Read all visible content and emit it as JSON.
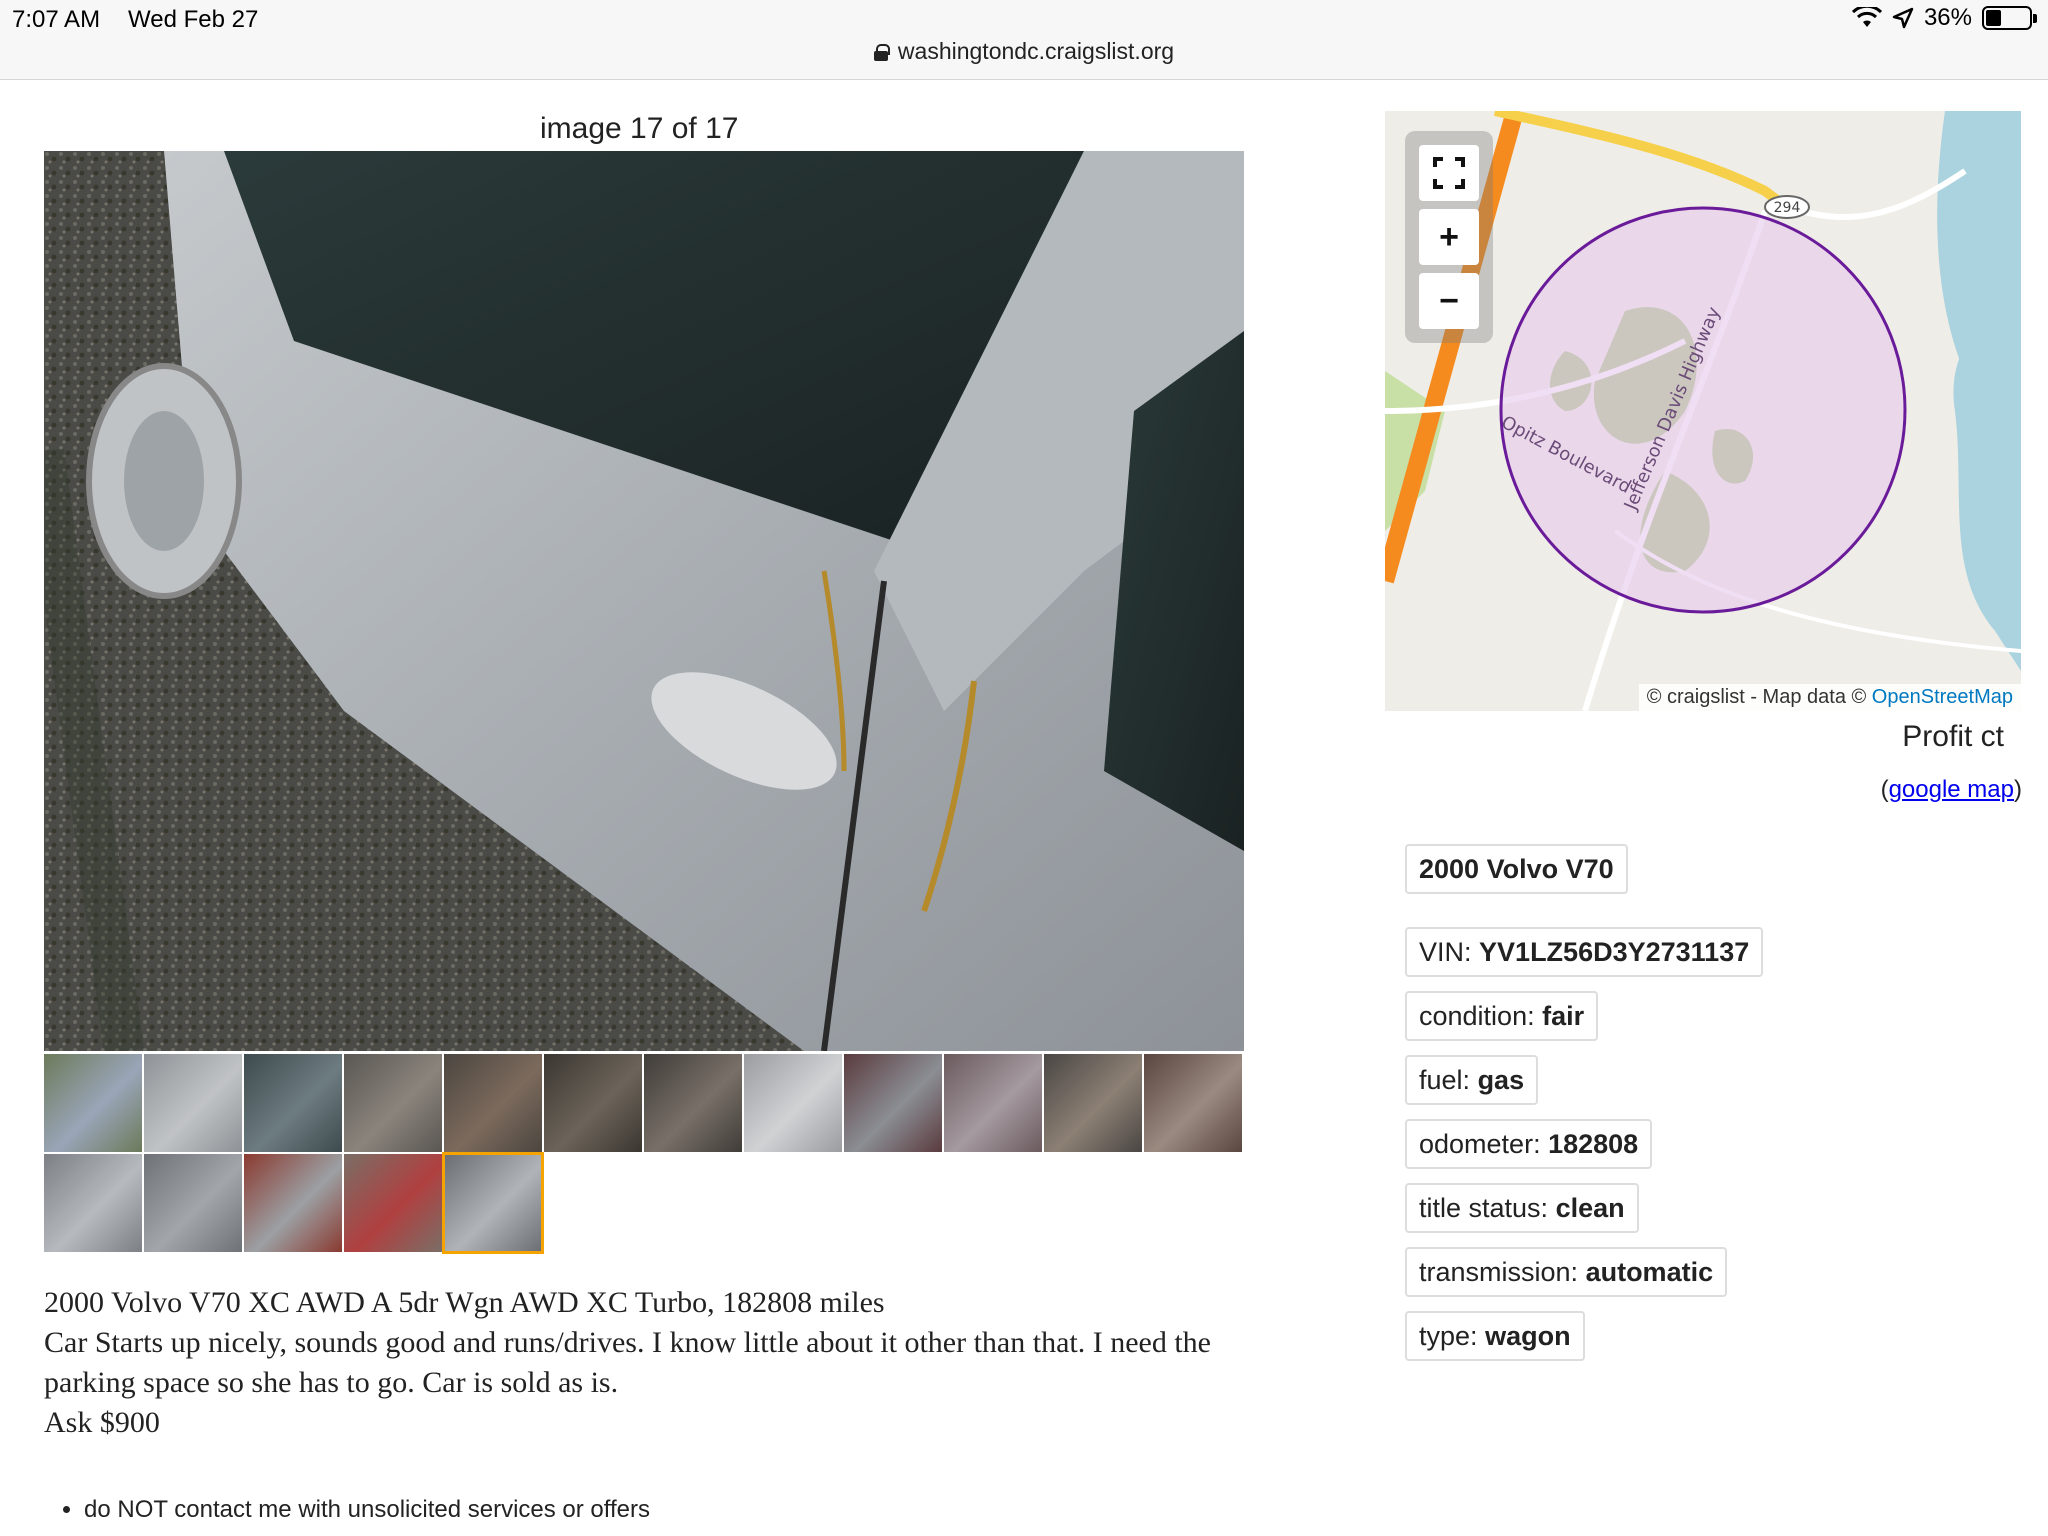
{
  "status_bar": {
    "time": "7:07 AM",
    "date": "Wed Feb 27",
    "battery_percent": "36%",
    "battery_level": 0.36,
    "icons": [
      "wifi-icon",
      "location-arrow-icon",
      "battery-icon"
    ]
  },
  "browser": {
    "url": "washingtondc.craigslist.org",
    "lock_icon": "lock-icon"
  },
  "gallery": {
    "counter": "image 17 of 17",
    "total": 17,
    "selected_index": 17
  },
  "map": {
    "controls": [
      "fullscreen-icon",
      "zoom-in-icon",
      "zoom-out-icon"
    ],
    "road_labels": [
      "294",
      "Opitz Boulevard",
      "Jefferson Davis Highway"
    ],
    "attribution_prefix": "© craigslist - Map data ©",
    "attribution_link": "OpenStreetMap",
    "area_label": "Profit ct",
    "google_map_open": "(",
    "google_map_link": "google map",
    "google_map_close": ")"
  },
  "attributes": {
    "title": "2000 Volvo V70",
    "vin_label": "VIN:",
    "vin_value": "YV1LZ56D3Y2731137",
    "condition_label": "condition:",
    "condition_value": "fair",
    "fuel_label": "fuel:",
    "fuel_value": "gas",
    "odometer_label": "odometer:",
    "odometer_value": "182808",
    "title_status_label": "title status:",
    "title_status_value": "clean",
    "transmission_label": "transmission:",
    "transmission_value": "automatic",
    "type_label": "type:",
    "type_value": "wagon"
  },
  "posting": {
    "line1": "2000 Volvo V70 XC AWD A 5dr Wgn AWD XC Turbo, 182808 miles",
    "line2": "Car Starts up nicely, sounds good and runs/drives. I know little about it other than that. I need the parking space so she has to go. Car is sold as is.",
    "line3": "Ask $900"
  },
  "notices": [
    "do NOT contact me with unsolicited services or offers"
  ],
  "colors": {
    "selected_thumb_border": "#f4a300",
    "link": "#0000ee",
    "osm_link": "#0079c1",
    "map_circle_fill": "#e6c9ec",
    "map_circle_stroke": "#6a1b9a",
    "highway": "#f7941d"
  }
}
